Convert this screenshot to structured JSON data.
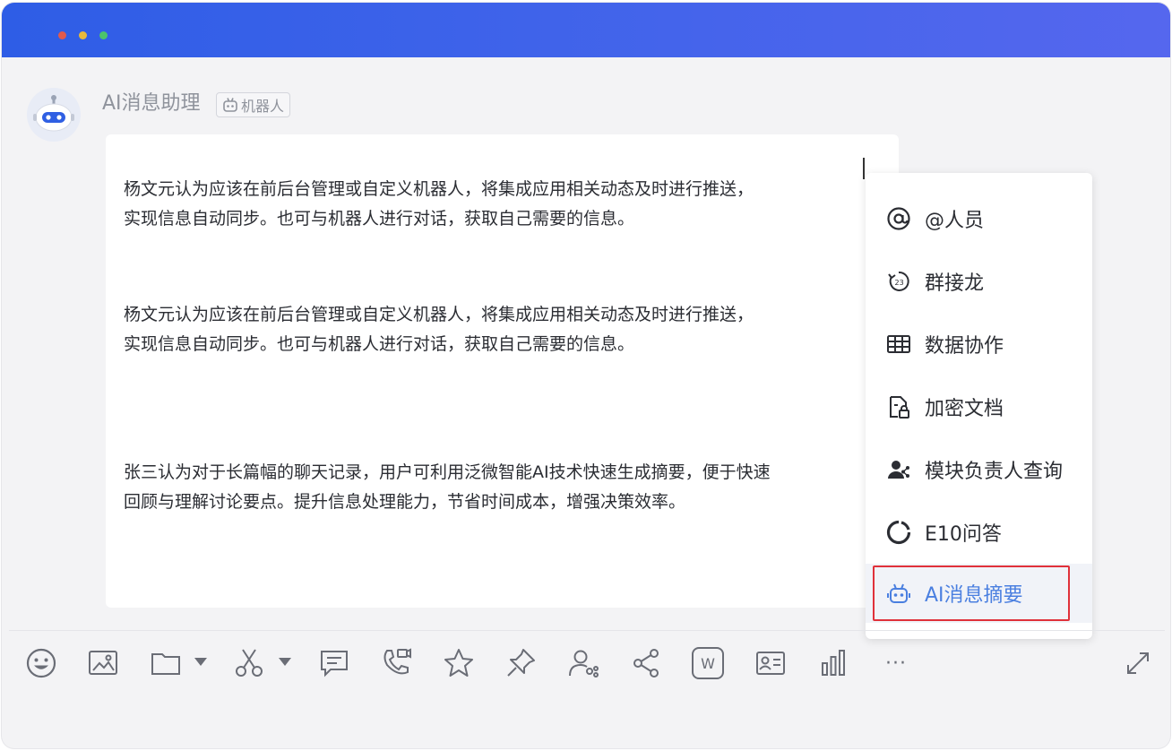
{
  "window": {
    "traffic_lights": [
      "close",
      "minimize",
      "maximize"
    ],
    "titlebar_gradient": [
      "#2e5de6",
      "#5567ee"
    ]
  },
  "message": {
    "sender": "AI消息助理",
    "tag": "机器人",
    "paragraphs": [
      [
        "杨文元认为应该在前后台管理或自定义机器人，将集成应用相关动态及时进行推送，",
        "实现信息自动同步。也可与机器人进行对话，获取自己需要的信息。"
      ],
      [
        "杨文元认为应该在前后台管理或自定义机器人，将集成应用相关动态及时进行推送，",
        "实现信息自动同步。也可与机器人进行对话，获取自己需要的信息。"
      ],
      [
        "张三认为对于长篇幅的聊天记录，用户可利用泛微智能AI技术快速生成摘要，便于快速",
        "回顾与理解讨论要点。提升信息处理能力，节省时间成本，增强决策效率。"
      ]
    ]
  },
  "menu": {
    "items": [
      {
        "label": "@人员",
        "icon": "at-icon"
      },
      {
        "label": "群接龙",
        "icon": "relay-icon"
      },
      {
        "label": "数据协作",
        "icon": "table-icon"
      },
      {
        "label": "加密文档",
        "icon": "locked-file-icon"
      },
      {
        "label": "模块负责人查询",
        "icon": "person-share-icon"
      },
      {
        "label": "E10问答",
        "icon": "ring-icon"
      },
      {
        "label": "AI消息摘要",
        "icon": "robot-icon",
        "active": true
      }
    ],
    "active_color": "#4a7fe0",
    "highlight_color": "#e0313a"
  },
  "toolbar": {
    "icons": [
      "emoji-icon",
      "image-icon",
      "folder-icon",
      "scissors-icon",
      "comment-icon",
      "phone-video-icon",
      "star-icon",
      "pin-icon",
      "user-link-icon",
      "share-icon",
      "word-icon",
      "contact-card-icon",
      "chart-icon",
      "more-icon",
      "expand-icon"
    ],
    "more_label": "···",
    "word_label": "W"
  }
}
